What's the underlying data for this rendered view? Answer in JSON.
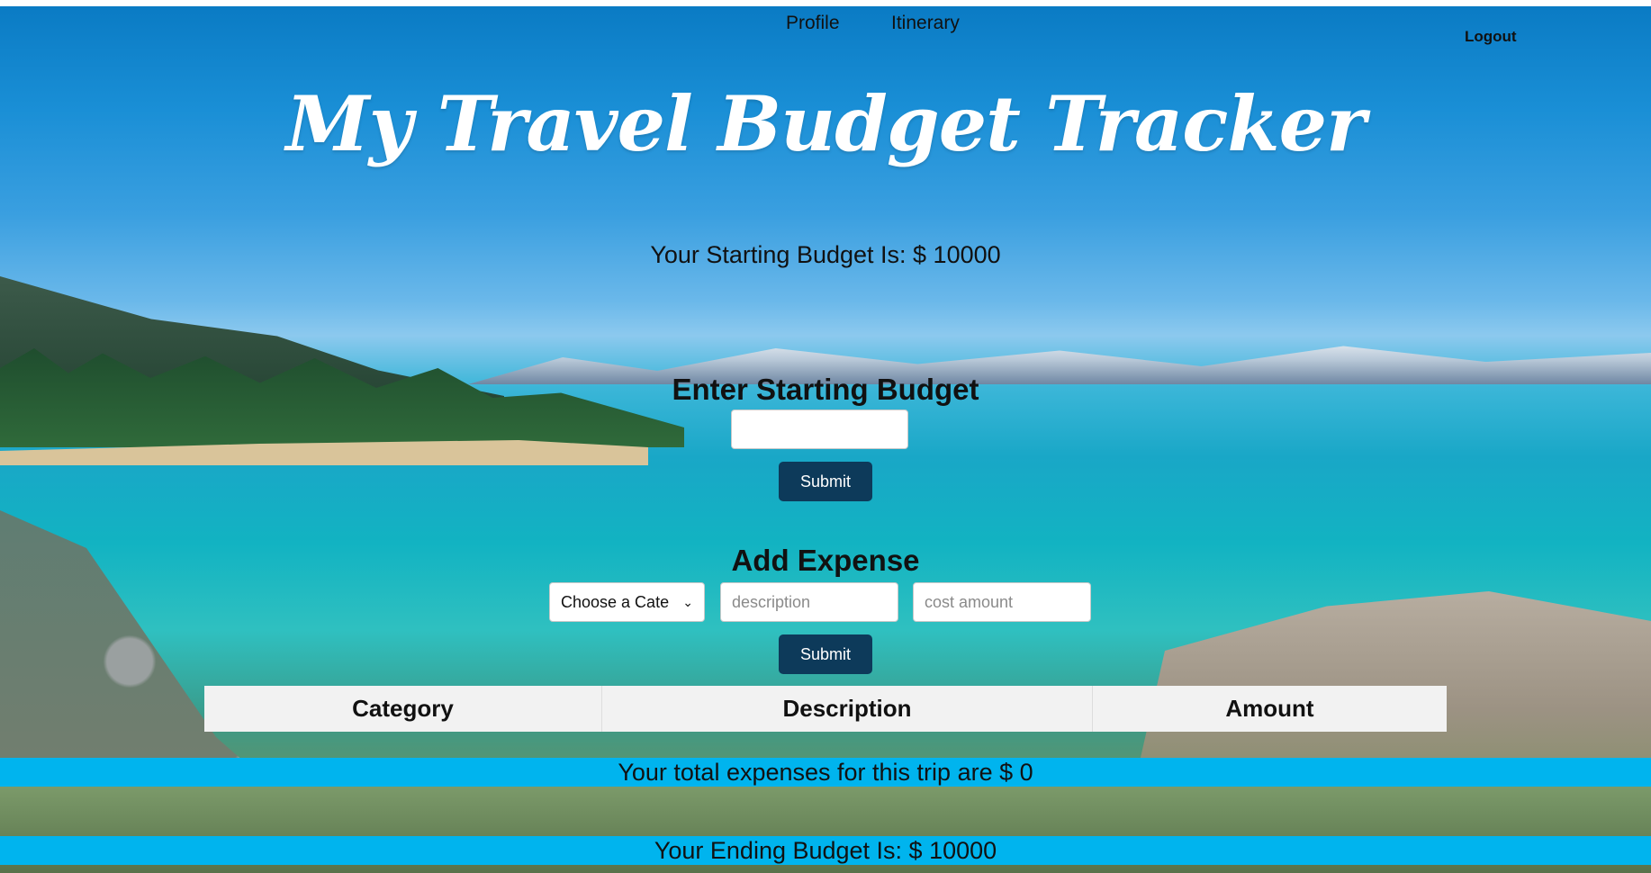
{
  "nav": {
    "profile": "Profile",
    "itinerary": "Itinerary",
    "logout": "Logout"
  },
  "header": {
    "title": "My Travel Budget Tracker"
  },
  "budget": {
    "starting_text": "Your Starting Budget Is: $ 10000"
  },
  "enter_budget": {
    "heading": "Enter Starting Budget",
    "value": "",
    "submit_label": "Submit"
  },
  "add_expense": {
    "heading": "Add Expense",
    "category_selected": "Choose a Cate",
    "description_placeholder": "description",
    "cost_placeholder": "cost amount",
    "submit_label": "Submit"
  },
  "table": {
    "columns": [
      "Category",
      "Description",
      "Amount"
    ]
  },
  "summary": {
    "total_text": "Your total expenses for this trip are $ 0",
    "ending_text": "Your Ending Budget Is: $ 10000"
  },
  "colors": {
    "button": "#0d3a5a",
    "band": "#00b4ee",
    "title": "#ffffff"
  }
}
